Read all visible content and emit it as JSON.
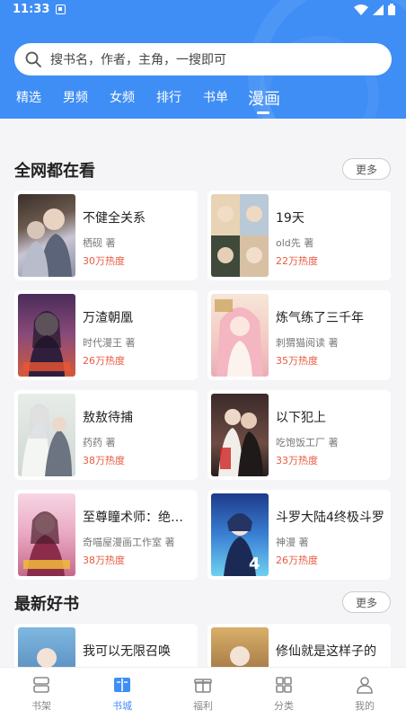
{
  "status": {
    "time": "11:33"
  },
  "search": {
    "placeholder": "搜书名，作者，主角，一搜即可"
  },
  "tabs": [
    {
      "label": "精选"
    },
    {
      "label": "男频"
    },
    {
      "label": "女频"
    },
    {
      "label": "排行"
    },
    {
      "label": "书单"
    },
    {
      "label": "漫画"
    }
  ],
  "active_tab": "漫画",
  "section1": {
    "title": "全网都在看",
    "more": "更多",
    "books": [
      {
        "title": "不健全关系",
        "author": "栖砚 著",
        "heat": "30万热度"
      },
      {
        "title": "19天",
        "author": "old先 著",
        "heat": "22万热度"
      },
      {
        "title": "万渣朝凰",
        "author": "时代漫王 著",
        "heat": "26万热度"
      },
      {
        "title": "炼气练了三千年",
        "author": "刺猬猫阅读 著",
        "heat": "35万热度"
      },
      {
        "title": "敖敖待捕",
        "author": "药药 著",
        "heat": "38万热度"
      },
      {
        "title": "以下犯上",
        "author": "吃饱饭工厂 著",
        "heat": "33万热度"
      },
      {
        "title": "至尊瞳术师：绝世...",
        "author": "奇喵屋漫画工作室 著",
        "heat": "38万热度"
      },
      {
        "title": "斗罗大陆4终极斗罗",
        "author": "神漫 著",
        "heat": "26万热度"
      }
    ]
  },
  "section2": {
    "title": "最新好书",
    "more": "更多",
    "books": [
      {
        "title": "我可以无限召唤"
      },
      {
        "title": "修仙就是这样子的"
      }
    ]
  },
  "bottom_nav": [
    {
      "label": "书架",
      "icon": "bookshelf-icon"
    },
    {
      "label": "书城",
      "icon": "bookstore-icon"
    },
    {
      "label": "福利",
      "icon": "gift-icon"
    },
    {
      "label": "分类",
      "icon": "category-icon"
    },
    {
      "label": "我的",
      "icon": "profile-icon"
    }
  ],
  "active_nav": "书城",
  "colors": {
    "accent": "#3f8ef5",
    "heat": "#e85a40"
  }
}
